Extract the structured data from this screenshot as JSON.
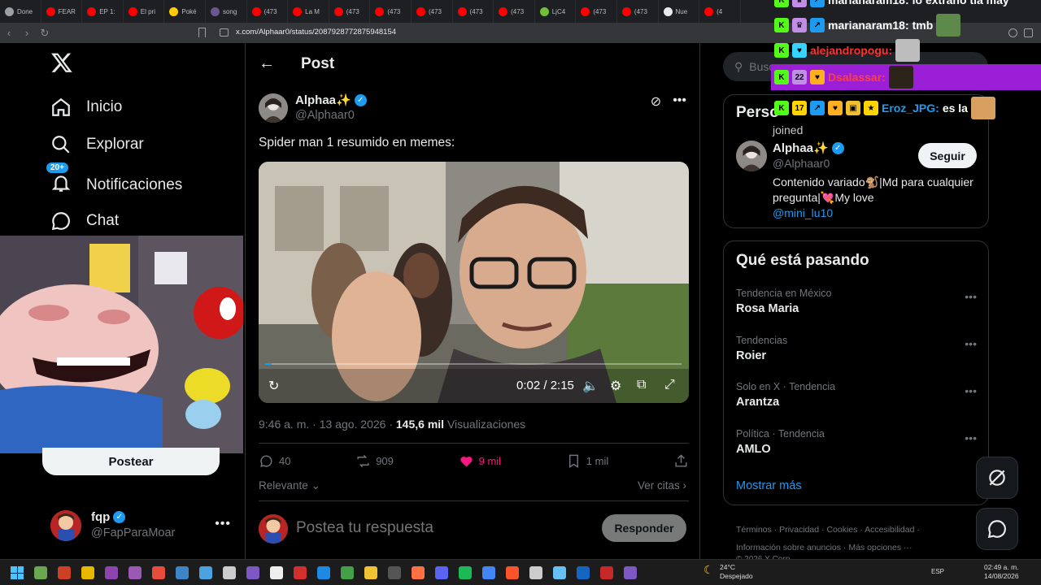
{
  "browser": {
    "tabs": [
      "Done",
      "FEAR",
      "EP 1:",
      "El pri",
      "Poké",
      "song",
      "(473",
      "La M",
      "(473",
      "(473",
      "(473",
      "(473",
      "(473",
      "LjC4",
      "(473",
      "(473",
      "Nue",
      "(4"
    ],
    "tab_colors": [
      "#9aa0a6",
      "#ff0000",
      "#ff0000",
      "#ff0000",
      "#ffcb05",
      "#6e5494",
      "#ff0000",
      "#ff0000",
      "#ff0000",
      "#ff0000",
      "#ff0000",
      "#ff0000",
      "#ff0000",
      "#6fbf3a",
      "#ff0000",
      "#ff0000",
      "#e8eaed",
      "#ff0000"
    ],
    "url": "x.com/Alphaar0/status/2087928772875948154"
  },
  "nav": {
    "home": "Inicio",
    "explore": "Explorar",
    "notifications": "Notificaciones",
    "notif_badge": "20+",
    "chat": "Chat",
    "post_button": "Postear",
    "me_name": "fqp",
    "me_handle": "@FapParaMoar"
  },
  "post": {
    "header_title": "Post",
    "author_name": "Alphaa✨",
    "author_handle": "@Alphaar0",
    "text": "Spider man 1 resumido en memes:",
    "video_time": "0:02 / 2:15",
    "video_progress": 0.015,
    "timestamp": "9:46 a. m. · 13 ago. 2026 · ",
    "views_count": "145,6 mil",
    "views_label": "Visualizaciones",
    "replies": "40",
    "reposts": "909",
    "likes": "9 mil",
    "bookmarks": "1 mil",
    "sort_label": "Relevante",
    "quotes_label": "Ver citas",
    "reply_placeholder": "Postea tu respuesta",
    "reply_button": "Responder",
    "like_color": "#f91880"
  },
  "sidebar": {
    "search_placeholder": "Busc",
    "who_title": "Perso",
    "who_name": "Alphaa✨",
    "who_handle": "@Alphaar0",
    "follow_label": "Seguir",
    "who_bio": "Contenido variado🐒|Md para cualquier pregunta|💘My love",
    "who_bio_link": "@mini_lu10",
    "trending_title": "Qué está pasando",
    "trends": [
      {
        "context": "Tendencia en México",
        "name": "Rosa Maria"
      },
      {
        "context": "Tendencias",
        "name": "Roier"
      },
      {
        "context": "Solo en X · Tendencia",
        "name": "Arantza"
      },
      {
        "context": "Política · Tendencia",
        "name": "AMLO"
      }
    ],
    "show_more": "Mostrar más",
    "footer_1": "Términos · Privacidad · Cookies · Accesibilidad ·",
    "footer_2": "Información sobre anuncios · Más opciones ···",
    "footer_3": "© 2026 X Corp."
  },
  "chat_overlay": {
    "line1_user": "marianaram18:",
    "line1_msg": "lo extraño tia may",
    "line2_user": "marianaram18:",
    "line2_msg": "tmb",
    "line3_user": "alejandropogu:",
    "line4_user": "Dsalassar:",
    "line5_user": "Eroz_JPG:",
    "line5_msg": "es la",
    "line5_badge": "17",
    "line3_badge": "22",
    "joined": "joined",
    "highlight_color": "#9b1fd6"
  },
  "taskbar": {
    "weather_temp": "24°C",
    "weather_desc": "Despejado",
    "lang": "ESP",
    "time": "02:49 a. m.",
    "date": "14/08/2026"
  }
}
